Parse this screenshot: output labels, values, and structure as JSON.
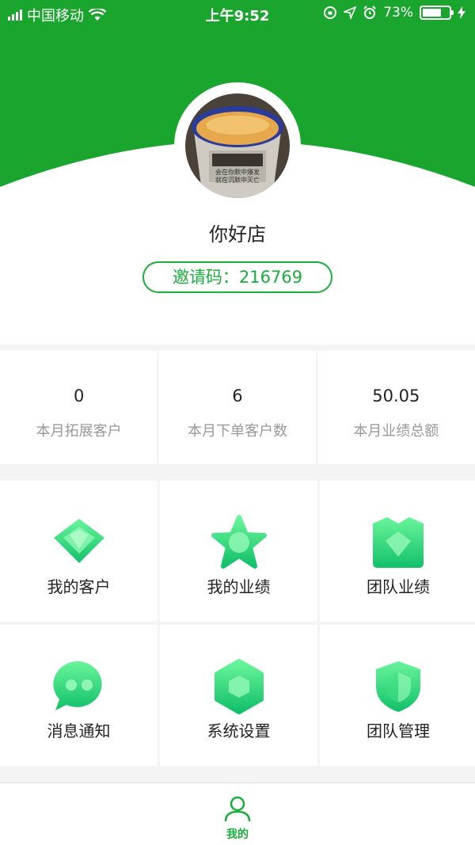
{
  "colors": {
    "brand_green": "#1aad3b",
    "icon_green_light": "#5ef08c",
    "icon_green_dark": "#15c46e"
  },
  "status_bar": {
    "carrier": "中国移动",
    "time": "上午9:52",
    "battery_percent": "73%",
    "battery_level": 0.73,
    "icons": [
      "signal-icon",
      "wifi-icon",
      "orientation-lock-icon",
      "location-icon",
      "alarm-icon",
      "battery-icon",
      "charging-icon"
    ]
  },
  "profile": {
    "store_name": "你好店",
    "invite_code": "邀请码：216769",
    "avatar_text": [
      "会在你默中爆发",
      "就在沉默中灭亡"
    ]
  },
  "stats": [
    {
      "value": "0",
      "label": "本月拓展客户"
    },
    {
      "value": "6",
      "label": "本月下单客户数"
    },
    {
      "value": "50.05",
      "label": "本月业绩总额"
    }
  ],
  "menu": [
    {
      "label": "我的客户",
      "icon": "diamond-icon"
    },
    {
      "label": "我的业绩",
      "icon": "star-icon"
    },
    {
      "label": "团队业绩",
      "icon": "crown-icon"
    },
    {
      "label": "消息通知",
      "icon": "chat-bubble-icon"
    },
    {
      "label": "系统设置",
      "icon": "hexagon-icon"
    },
    {
      "label": "团队管理",
      "icon": "shield-icon"
    }
  ],
  "tabbar": {
    "items": [
      {
        "label": "我的",
        "icon": "person-icon"
      }
    ]
  }
}
